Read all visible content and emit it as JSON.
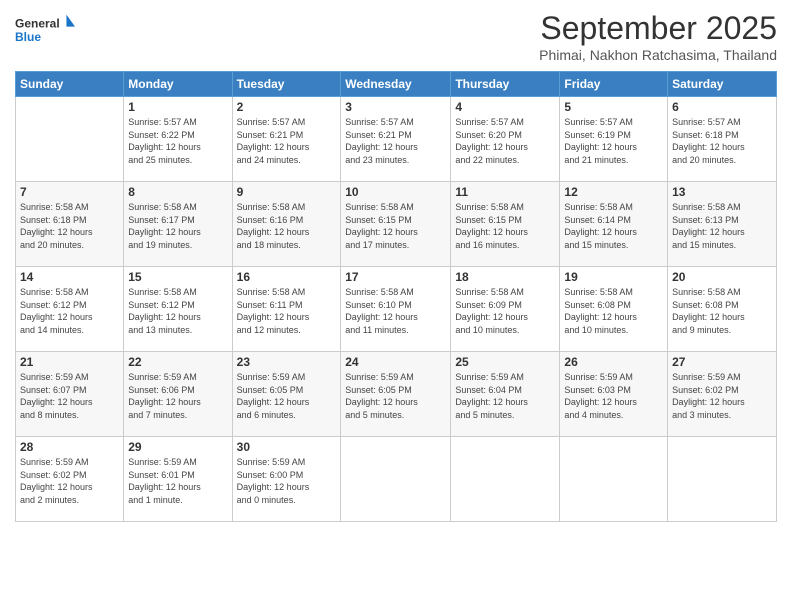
{
  "logo": {
    "line1": "General",
    "line2": "Blue"
  },
  "title": "September 2025",
  "subtitle": "Phimai, Nakhon Ratchasima, Thailand",
  "days_header": [
    "Sunday",
    "Monday",
    "Tuesday",
    "Wednesday",
    "Thursday",
    "Friday",
    "Saturday"
  ],
  "weeks": [
    [
      {
        "day": "",
        "info": ""
      },
      {
        "day": "1",
        "info": "Sunrise: 5:57 AM\nSunset: 6:22 PM\nDaylight: 12 hours\nand 25 minutes."
      },
      {
        "day": "2",
        "info": "Sunrise: 5:57 AM\nSunset: 6:21 PM\nDaylight: 12 hours\nand 24 minutes."
      },
      {
        "day": "3",
        "info": "Sunrise: 5:57 AM\nSunset: 6:21 PM\nDaylight: 12 hours\nand 23 minutes."
      },
      {
        "day": "4",
        "info": "Sunrise: 5:57 AM\nSunset: 6:20 PM\nDaylight: 12 hours\nand 22 minutes."
      },
      {
        "day": "5",
        "info": "Sunrise: 5:57 AM\nSunset: 6:19 PM\nDaylight: 12 hours\nand 21 minutes."
      },
      {
        "day": "6",
        "info": "Sunrise: 5:57 AM\nSunset: 6:18 PM\nDaylight: 12 hours\nand 20 minutes."
      }
    ],
    [
      {
        "day": "7",
        "info": "Sunrise: 5:58 AM\nSunset: 6:18 PM\nDaylight: 12 hours\nand 20 minutes."
      },
      {
        "day": "8",
        "info": "Sunrise: 5:58 AM\nSunset: 6:17 PM\nDaylight: 12 hours\nand 19 minutes."
      },
      {
        "day": "9",
        "info": "Sunrise: 5:58 AM\nSunset: 6:16 PM\nDaylight: 12 hours\nand 18 minutes."
      },
      {
        "day": "10",
        "info": "Sunrise: 5:58 AM\nSunset: 6:15 PM\nDaylight: 12 hours\nand 17 minutes."
      },
      {
        "day": "11",
        "info": "Sunrise: 5:58 AM\nSunset: 6:15 PM\nDaylight: 12 hours\nand 16 minutes."
      },
      {
        "day": "12",
        "info": "Sunrise: 5:58 AM\nSunset: 6:14 PM\nDaylight: 12 hours\nand 15 minutes."
      },
      {
        "day": "13",
        "info": "Sunrise: 5:58 AM\nSunset: 6:13 PM\nDaylight: 12 hours\nand 15 minutes."
      }
    ],
    [
      {
        "day": "14",
        "info": "Sunrise: 5:58 AM\nSunset: 6:12 PM\nDaylight: 12 hours\nand 14 minutes."
      },
      {
        "day": "15",
        "info": "Sunrise: 5:58 AM\nSunset: 6:12 PM\nDaylight: 12 hours\nand 13 minutes."
      },
      {
        "day": "16",
        "info": "Sunrise: 5:58 AM\nSunset: 6:11 PM\nDaylight: 12 hours\nand 12 minutes."
      },
      {
        "day": "17",
        "info": "Sunrise: 5:58 AM\nSunset: 6:10 PM\nDaylight: 12 hours\nand 11 minutes."
      },
      {
        "day": "18",
        "info": "Sunrise: 5:58 AM\nSunset: 6:09 PM\nDaylight: 12 hours\nand 10 minutes."
      },
      {
        "day": "19",
        "info": "Sunrise: 5:58 AM\nSunset: 6:08 PM\nDaylight: 12 hours\nand 10 minutes."
      },
      {
        "day": "20",
        "info": "Sunrise: 5:58 AM\nSunset: 6:08 PM\nDaylight: 12 hours\nand 9 minutes."
      }
    ],
    [
      {
        "day": "21",
        "info": "Sunrise: 5:59 AM\nSunset: 6:07 PM\nDaylight: 12 hours\nand 8 minutes."
      },
      {
        "day": "22",
        "info": "Sunrise: 5:59 AM\nSunset: 6:06 PM\nDaylight: 12 hours\nand 7 minutes."
      },
      {
        "day": "23",
        "info": "Sunrise: 5:59 AM\nSunset: 6:05 PM\nDaylight: 12 hours\nand 6 minutes."
      },
      {
        "day": "24",
        "info": "Sunrise: 5:59 AM\nSunset: 6:05 PM\nDaylight: 12 hours\nand 5 minutes."
      },
      {
        "day": "25",
        "info": "Sunrise: 5:59 AM\nSunset: 6:04 PM\nDaylight: 12 hours\nand 5 minutes."
      },
      {
        "day": "26",
        "info": "Sunrise: 5:59 AM\nSunset: 6:03 PM\nDaylight: 12 hours\nand 4 minutes."
      },
      {
        "day": "27",
        "info": "Sunrise: 5:59 AM\nSunset: 6:02 PM\nDaylight: 12 hours\nand 3 minutes."
      }
    ],
    [
      {
        "day": "28",
        "info": "Sunrise: 5:59 AM\nSunset: 6:02 PM\nDaylight: 12 hours\nand 2 minutes."
      },
      {
        "day": "29",
        "info": "Sunrise: 5:59 AM\nSunset: 6:01 PM\nDaylight: 12 hours\nand 1 minute."
      },
      {
        "day": "30",
        "info": "Sunrise: 5:59 AM\nSunset: 6:00 PM\nDaylight: 12 hours\nand 0 minutes."
      },
      {
        "day": "",
        "info": ""
      },
      {
        "day": "",
        "info": ""
      },
      {
        "day": "",
        "info": ""
      },
      {
        "day": "",
        "info": ""
      }
    ]
  ]
}
